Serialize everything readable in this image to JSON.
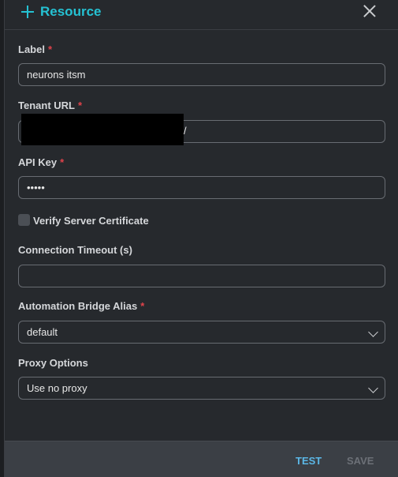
{
  "header": {
    "title": "Resource",
    "icon": "plus-icon",
    "close_icon": "close-icon"
  },
  "fields": {
    "label": {
      "label": "Label",
      "required": "*",
      "value": "neurons itsm"
    },
    "tenant_url": {
      "label": "Tenant URL",
      "required": "*",
      "value_suffix": "/"
    },
    "api_key": {
      "label": "API Key",
      "required": "*",
      "value": "•••••"
    },
    "verify_cert": {
      "label": "Verify Server Certificate",
      "checked": false
    },
    "timeout": {
      "label": "Connection Timeout (s)",
      "value": ""
    },
    "bridge_alias": {
      "label": "Automation Bridge Alias",
      "required": "*",
      "value": "default"
    },
    "proxy": {
      "label": "Proxy Options",
      "value": "Use no proxy"
    }
  },
  "footer": {
    "test_label": "TEST",
    "save_label": "SAVE"
  },
  "colors": {
    "accent": "#25c2d3",
    "required": "#e0434b",
    "link": "#5bb7e6",
    "disabled": "#6c7077"
  }
}
